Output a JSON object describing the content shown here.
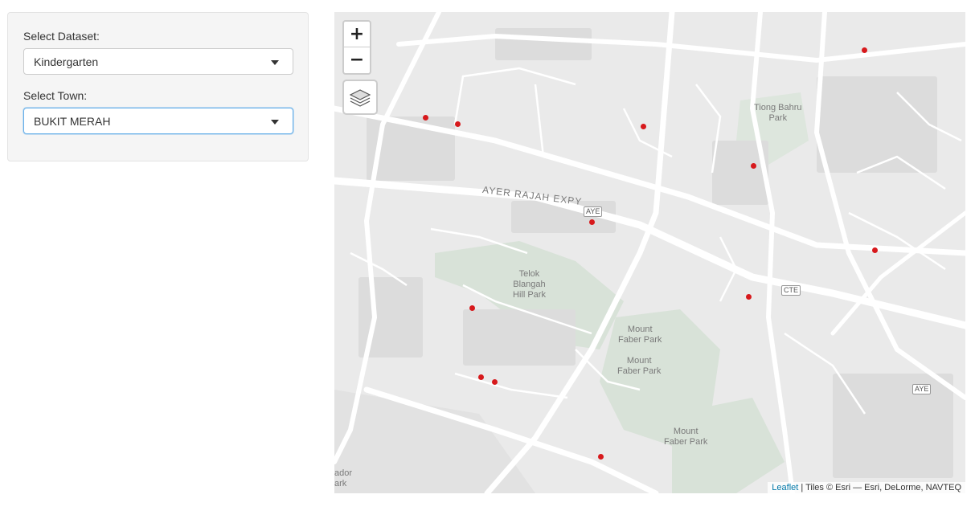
{
  "sidebar": {
    "dataset_label": "Select Dataset:",
    "dataset_value": "Kindergarten",
    "town_label": "Select Town:",
    "town_value": "BUKIT MERAH"
  },
  "map": {
    "zoom_in": "+",
    "zoom_out": "−",
    "layers_icon": "layers-icon",
    "attribution_link": "Leaflet",
    "attribution_text": " | Tiles © Esri — Esri, DeLorme, NAVTEQ",
    "marker_color": "#d7191c",
    "labels": {
      "expressway": "AYER RAJAH EXPY",
      "tiong_bahru_1": "Tiong Bahru",
      "tiong_bahru_2": "Park",
      "telok_1": "Telok",
      "telok_2": "Blangah",
      "telok_3": "Hill Park",
      "faber1_1": "Mount",
      "faber1_2": "Faber Park",
      "faber2_1": "Mount",
      "faber2_2": "Faber Park",
      "faber3_1": "Mount",
      "faber3_2": "Faber Park",
      "edge_1": "ador",
      "edge_2": "ark"
    },
    "shields": {
      "aye1": "AYE",
      "cte": "CTE",
      "aye2": "AYE"
    }
  }
}
